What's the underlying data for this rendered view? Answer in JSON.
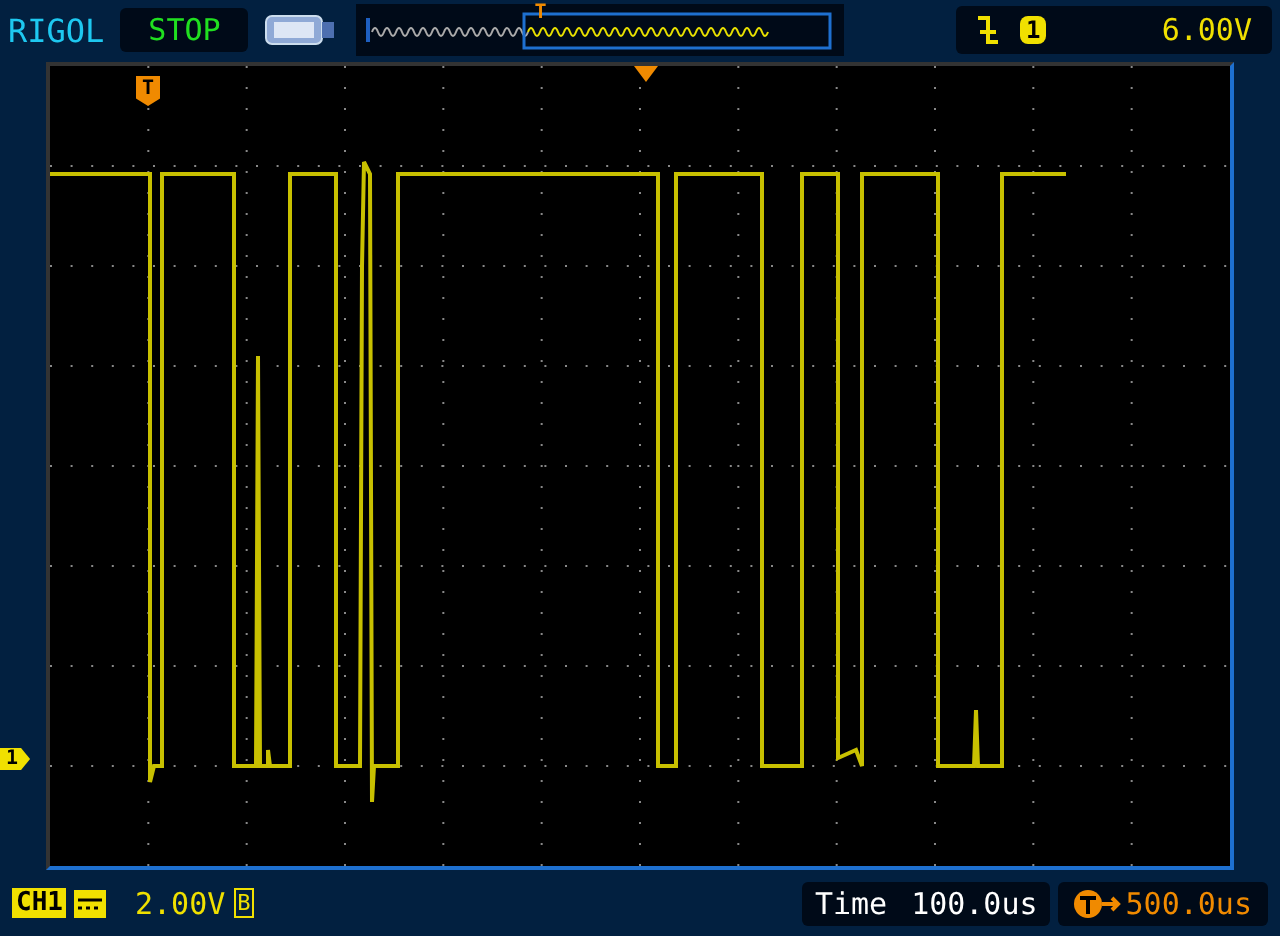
{
  "brand": "RIGOL",
  "run_state": "STOP",
  "overview": {
    "trigger_marker": "T"
  },
  "trigger": {
    "source": "1",
    "level": "6.00V"
  },
  "screen": {
    "trigger_marker": "T",
    "channel_marker": "1"
  },
  "channel": {
    "label": "CH1",
    "scale": "2.00V",
    "bandwidth_mark": "B"
  },
  "timebase": {
    "label": "Time",
    "value": "100.0us"
  },
  "trigger_offset": {
    "value": "500.0us"
  }
}
